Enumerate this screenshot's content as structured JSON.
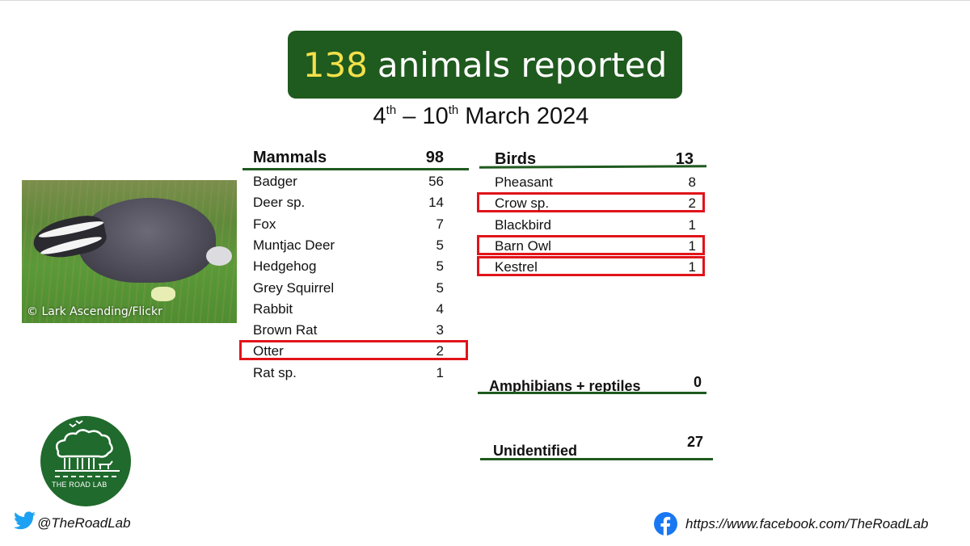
{
  "header": {
    "count": "138",
    "title_rest": "animals reported",
    "date": {
      "start_day": "4",
      "start_suffix": "th",
      "dash": "–",
      "end_day": "10",
      "end_suffix": "th",
      "month_year": "March 2024"
    }
  },
  "photo": {
    "subject": "badger",
    "credit": "© Lark Ascending/Flickr"
  },
  "mammals": {
    "label": "Mammals",
    "total": "98",
    "items": [
      {
        "name": "Badger",
        "count": "56",
        "highlighted": false
      },
      {
        "name": "Deer sp.",
        "count": "14",
        "highlighted": false
      },
      {
        "name": "Fox",
        "count": "7",
        "highlighted": false
      },
      {
        "name": "Muntjac Deer",
        "count": "5",
        "highlighted": false
      },
      {
        "name": "Hedgehog",
        "count": "5",
        "highlighted": false
      },
      {
        "name": "Grey Squirrel",
        "count": "5",
        "highlighted": false
      },
      {
        "name": "Rabbit",
        "count": "4",
        "highlighted": false
      },
      {
        "name": "Brown Rat",
        "count": "3",
        "highlighted": false
      },
      {
        "name": "Otter",
        "count": "2",
        "highlighted": true
      },
      {
        "name": "Rat sp.",
        "count": "1",
        "highlighted": false
      }
    ]
  },
  "birds": {
    "label": "Birds",
    "total": "13",
    "items": [
      {
        "name": "Pheasant",
        "count": "8",
        "highlighted": false
      },
      {
        "name": "Crow sp.",
        "count": "2",
        "highlighted": true
      },
      {
        "name": "Blackbird",
        "count": "1",
        "highlighted": false
      },
      {
        "name": "Barn Owl",
        "count": "1",
        "highlighted": true
      },
      {
        "name": "Kestrel",
        "count": "1",
        "highlighted": true
      }
    ]
  },
  "amphibians": {
    "label": "Amphibians + reptiles",
    "total": "0"
  },
  "unidentified": {
    "label": "Unidentified",
    "total": "27"
  },
  "footer": {
    "logo_text": "THE ROAD LAB",
    "twitter_icon": "twitter-bird-icon",
    "twitter_handle": "@TheRoadLab",
    "facebook_icon": "facebook-icon",
    "facebook_url": "https://www.facebook.com/TheRoadLab"
  },
  "colors": {
    "brand_green": "#1f5a1e",
    "highlight_red": "#e0141a",
    "title_yellow": "#f3e04a"
  }
}
